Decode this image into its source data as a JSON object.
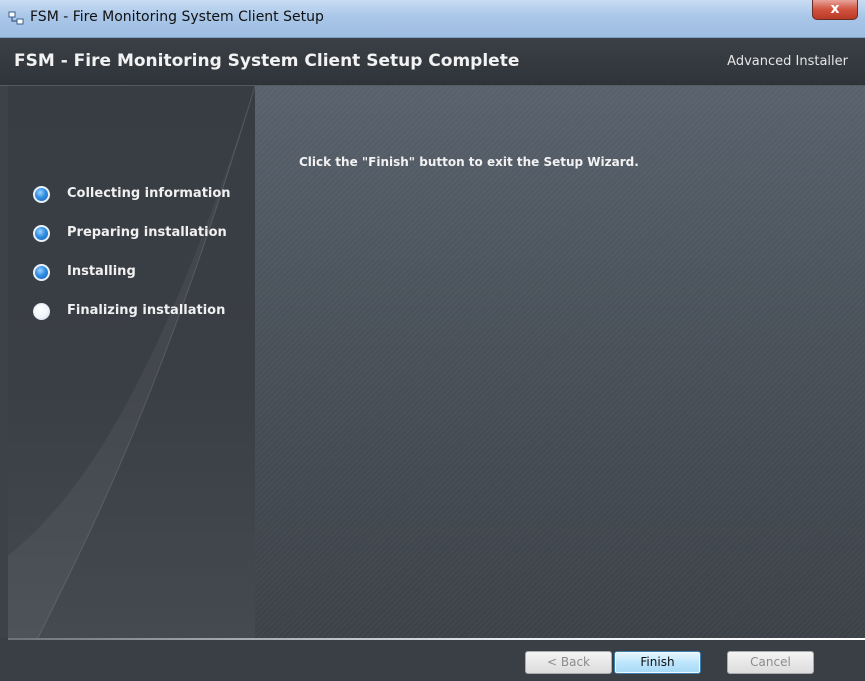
{
  "window": {
    "title": "FSM - Fire Monitoring System Client Setup",
    "close_label": "x"
  },
  "header": {
    "title": "FSM - Fire Monitoring System Client Setup Complete",
    "brand": "Advanced Installer"
  },
  "steps": [
    {
      "label": "Collecting information",
      "state": "done"
    },
    {
      "label": "Preparing installation",
      "state": "done"
    },
    {
      "label": "Installing",
      "state": "done"
    },
    {
      "label": "Finalizing installation",
      "state": "current"
    }
  ],
  "content": {
    "message": "Click the \"Finish\" button to exit the Setup Wizard."
  },
  "buttons": {
    "back": "< Back",
    "finish": "Finish",
    "cancel": "Cancel"
  },
  "colors": {
    "step_done": "#2f8ee3",
    "step_current": "#f0f5fa",
    "accent_finish": "#bee6fd"
  }
}
